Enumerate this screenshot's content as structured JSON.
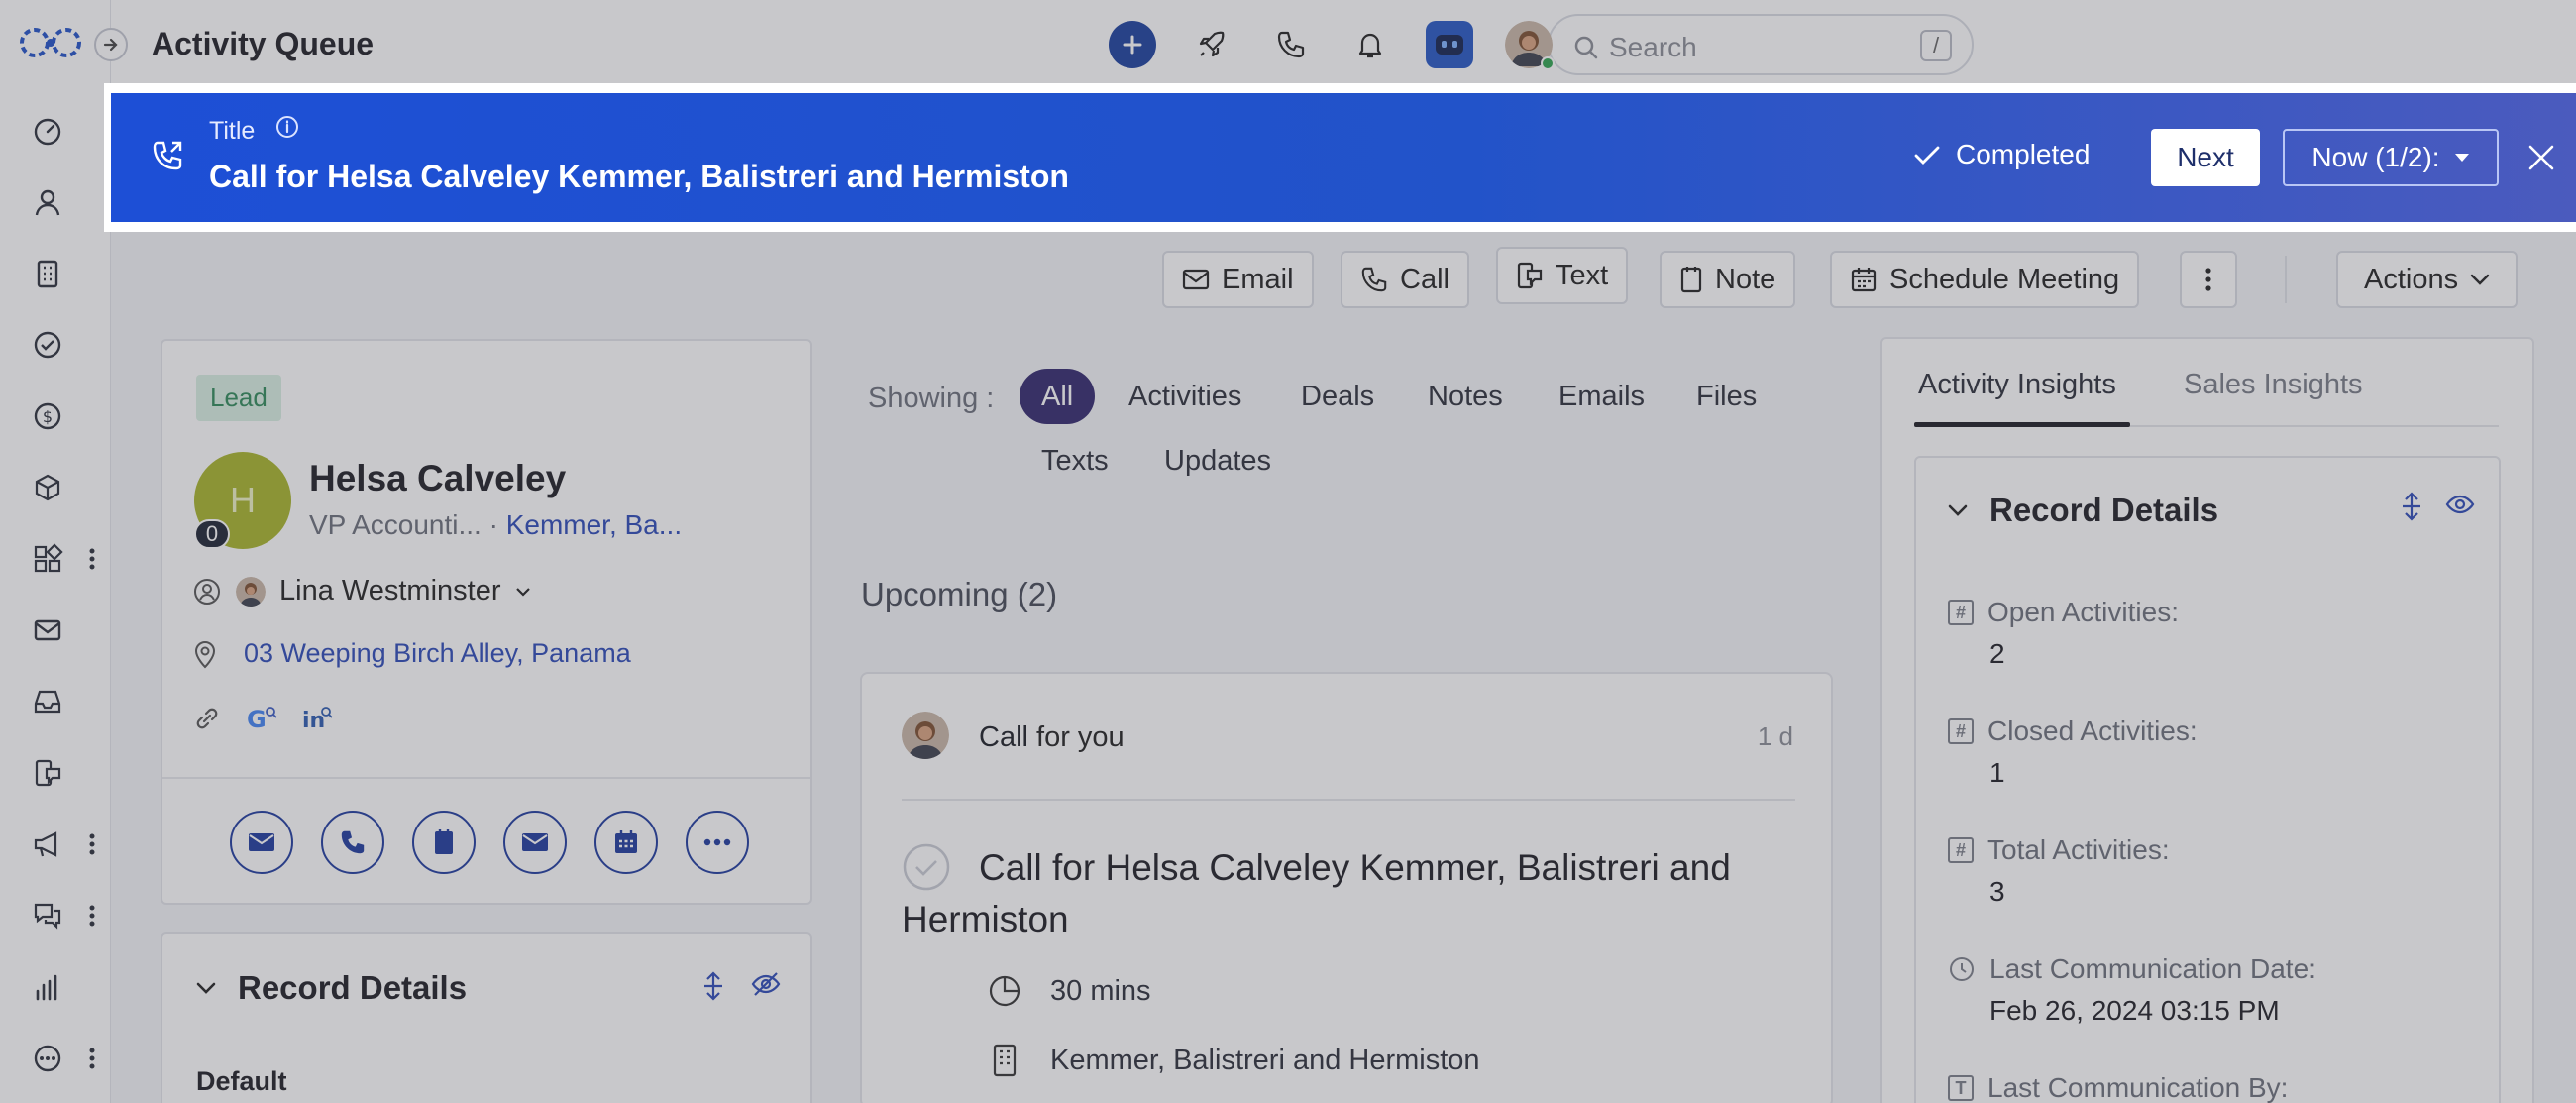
{
  "topbar": {
    "title": "Activity Queue",
    "search_placeholder": "Search",
    "search_shortcut": "/"
  },
  "banner": {
    "label": "Title",
    "title": "Call for Helsa Calveley Kemmer, Balistreri and Hermiston",
    "completed_label": "Completed",
    "next_label": "Next",
    "now_label": "Now (1/2):"
  },
  "toolbar": {
    "email": "Email",
    "call": "Call",
    "text": "Text",
    "note": "Note",
    "schedule": "Schedule Meeting",
    "actions": "Actions"
  },
  "contact": {
    "badge": "Lead",
    "initial": "H",
    "count": "0",
    "name": "Helsa Calveley",
    "role": "VP Accounti...",
    "separator": "·",
    "company": "Kemmer, Ba...",
    "owner": "Lina Westminster",
    "address": "03 Weeping Birch Alley, Panama"
  },
  "left_record": {
    "title": "Record Details",
    "group": "Default"
  },
  "filters": {
    "label": "Showing :",
    "items": [
      "All",
      "Activities",
      "Deals",
      "Notes",
      "Emails",
      "Files",
      "Texts",
      "Updates"
    ],
    "active": "All"
  },
  "upcoming": {
    "heading": "Upcoming (2)",
    "card": {
      "type": "Call",
      "for": "for you",
      "time": "1 d",
      "title": "Call for Helsa Calveley Kemmer, Balistreri and Hermiston",
      "duration": "30 mins",
      "company": "Kemmer, Balistreri and Hermiston"
    }
  },
  "insights": {
    "tabs": [
      "Activity Insights",
      "Sales Insights"
    ],
    "active_tab": "Activity Insights",
    "record_title": "Record Details",
    "fields": [
      {
        "label": "Open Activities:",
        "value": "2"
      },
      {
        "label": "Closed Activities:",
        "value": "1"
      },
      {
        "label": "Total Activities:",
        "value": "3"
      },
      {
        "label": "Last Communication Date:",
        "value": "Feb 26, 2024 03:15 PM"
      },
      {
        "label": "Last Communication By:",
        "value": ""
      }
    ]
  },
  "colors": {
    "brand": "#1d4fd6",
    "navy": "#1e3a9e",
    "chip_active": "#32286e",
    "lead_badge": "#d9efe3"
  }
}
